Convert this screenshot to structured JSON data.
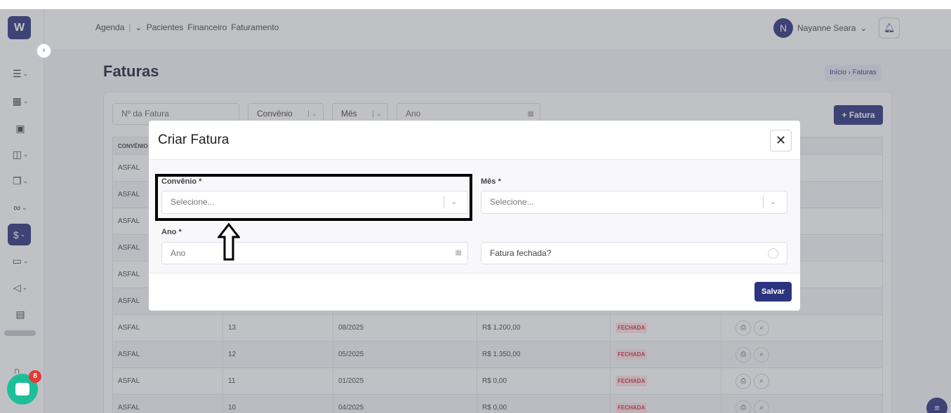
{
  "sidebar": {
    "logo": "W",
    "collapse_glyph": "›",
    "items": [
      {
        "icon": "list-icon",
        "glyph": "☰"
      },
      {
        "icon": "calendar-icon",
        "glyph": "▦"
      },
      {
        "icon": "id-card-icon",
        "glyph": "▣"
      },
      {
        "icon": "building-icon",
        "glyph": "◫"
      },
      {
        "icon": "documents-icon",
        "glyph": "❐"
      },
      {
        "icon": "handshake-icon",
        "glyph": "∞"
      },
      {
        "icon": "finance-icon",
        "glyph": "$"
      },
      {
        "icon": "monitor-icon",
        "glyph": "▭"
      },
      {
        "icon": "megaphone-icon",
        "glyph": "◁"
      },
      {
        "icon": "reports-icon",
        "glyph": "▤"
      }
    ],
    "chat_badge": "8"
  },
  "topbar": {
    "nav": [
      "Agenda",
      "Pacientes",
      "Financeiro",
      "Faturamento"
    ],
    "user_initial": "N",
    "user_name": "Nayanne Seara"
  },
  "page": {
    "title": "Faturas",
    "breadcrumb": "Início › Faturas"
  },
  "filters": {
    "invoice_number_placeholder": "Nº da Fatura",
    "convenio": "Convênio",
    "mes": "Mês",
    "ano_placeholder": "Ano",
    "new_button": "+ Fatura"
  },
  "table": {
    "header_first": "CONVÊNIO",
    "rows": [
      {
        "convenio": "ASFAL",
        "numero": "",
        "competencia": "",
        "valor": "",
        "status": ""
      },
      {
        "convenio": "ASFAL",
        "numero": "",
        "competencia": "",
        "valor": "",
        "status": ""
      },
      {
        "convenio": "ASFAL",
        "numero": "",
        "competencia": "",
        "valor": "",
        "status": ""
      },
      {
        "convenio": "ASFAL",
        "numero": "",
        "competencia": "",
        "valor": "",
        "status": ""
      },
      {
        "convenio": "ASFAL",
        "numero": "",
        "competencia": "",
        "valor": "",
        "status": ""
      },
      {
        "convenio": "ASFAL",
        "numero": "",
        "competencia": "",
        "valor": "",
        "status": ""
      },
      {
        "convenio": "ASFAL",
        "numero": "13",
        "competencia": "08/2025",
        "valor": "R$ 1.200,00",
        "status": "FECHADA"
      },
      {
        "convenio": "ASFAL",
        "numero": "12",
        "competencia": "05/2025",
        "valor": "R$ 1.350,00",
        "status": "FECHADA"
      },
      {
        "convenio": "ASFAL",
        "numero": "11",
        "competencia": "01/2025",
        "valor": "R$ 0,00",
        "status": "FECHADA"
      },
      {
        "convenio": "ASFAL",
        "numero": "10",
        "competencia": "04/2025",
        "valor": "R$ 0,00",
        "status": "FECHADA"
      }
    ]
  },
  "modal": {
    "title": "Criar Fatura",
    "close": "✕",
    "convenio_label": "Convênio *",
    "convenio_placeholder": "Selecione...",
    "mes_label": "Mês *",
    "mes_placeholder": "Selecione...",
    "ano_label": "Ano *",
    "ano_placeholder": "Ano",
    "fechada_label": "Fatura fechada?",
    "save": "Salvar"
  },
  "colors": {
    "brand": "#2c3480",
    "status_red": "#d32f4a",
    "chat_green": "#1dbf9b"
  }
}
